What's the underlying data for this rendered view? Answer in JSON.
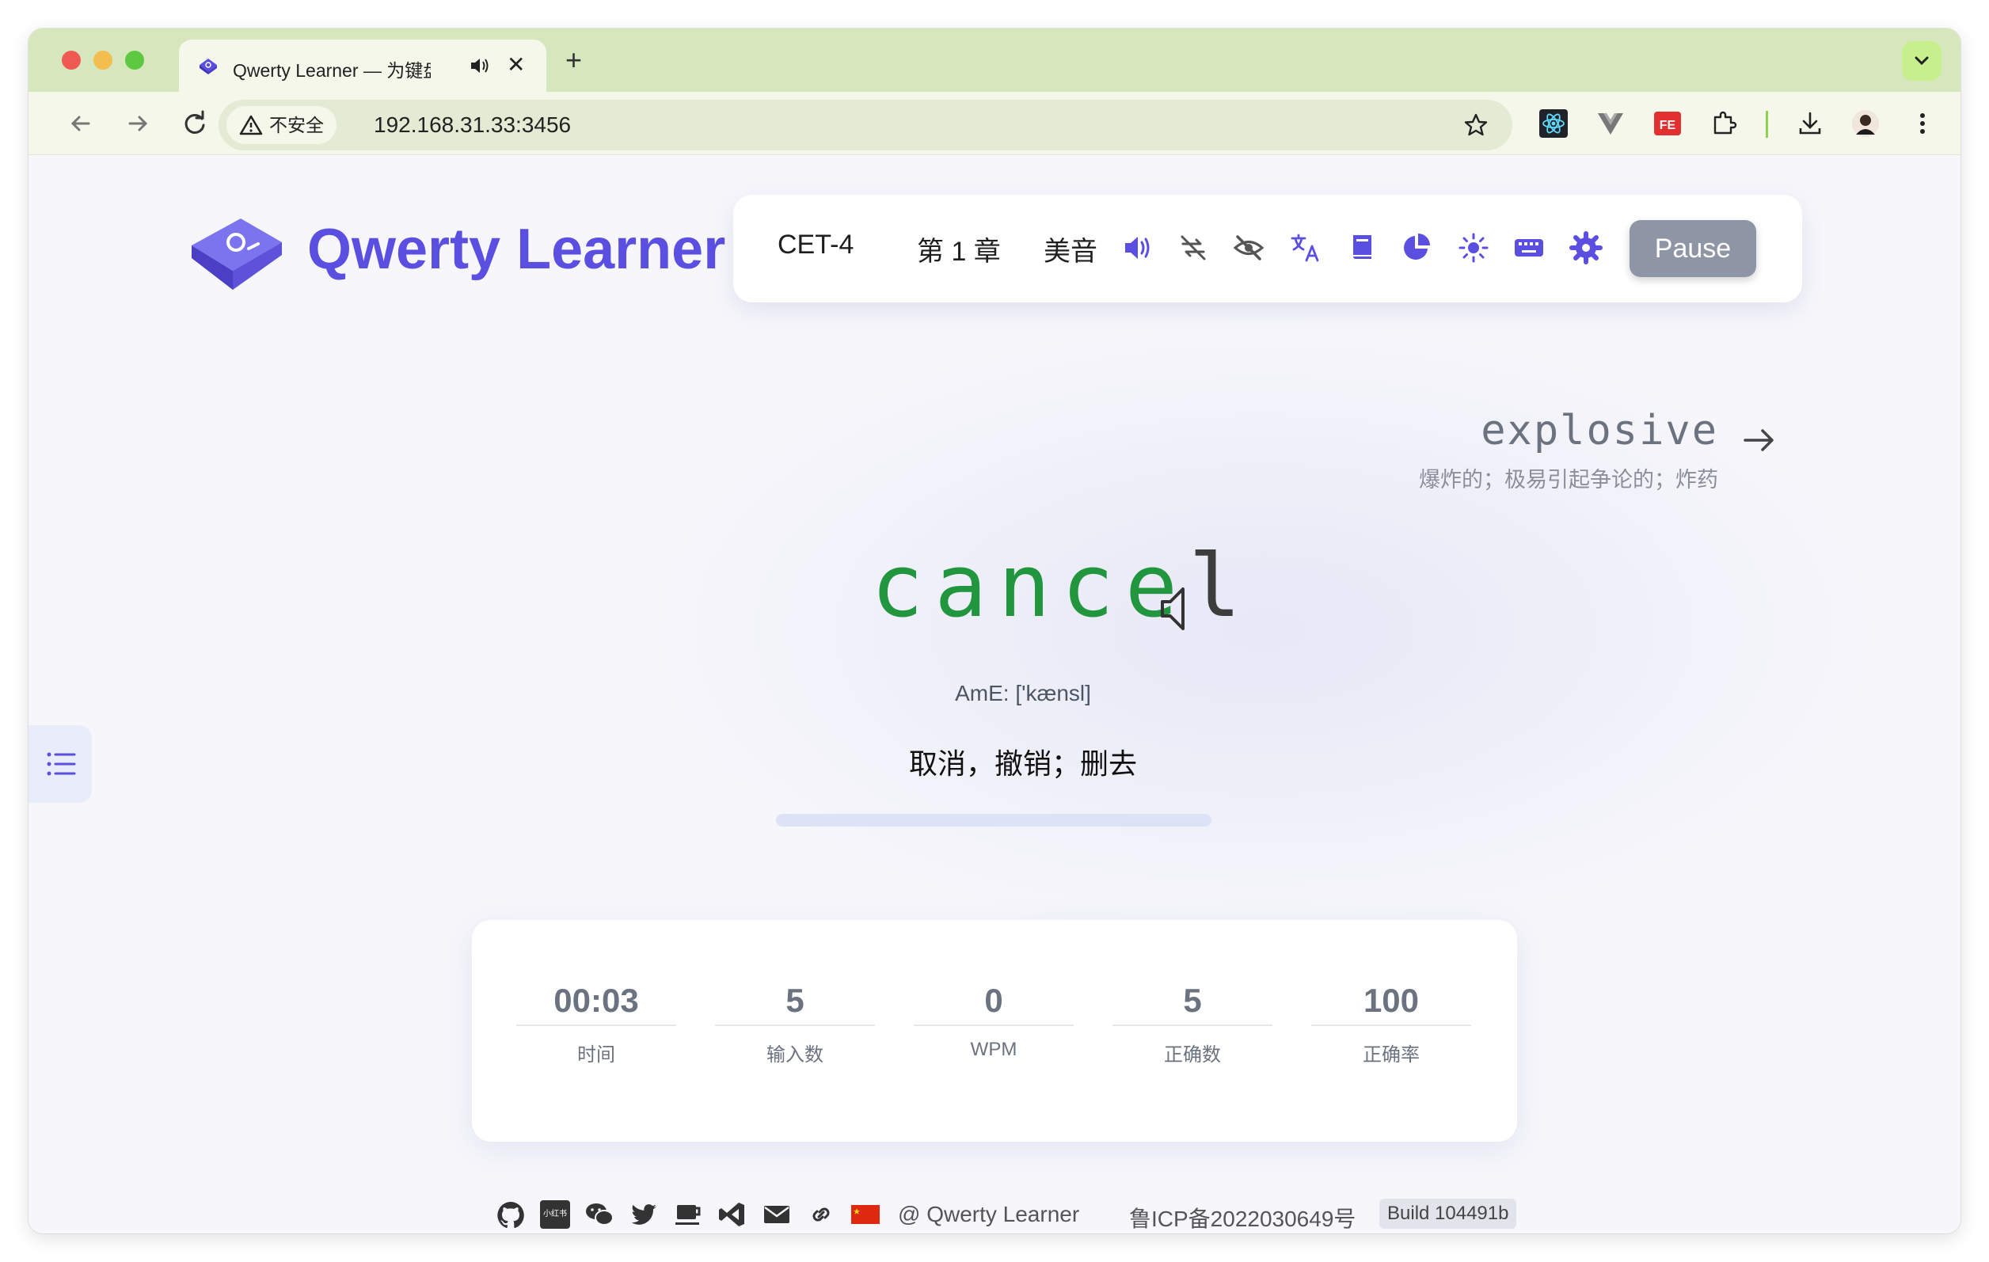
{
  "browser": {
    "tab_title": "Qwerty Learner — 为键盘工作者设计的单词记忆与英语肌肉记忆锻炼软件",
    "tab_close": "✕",
    "new_tab": "+",
    "insecure_label": "不安全",
    "url": "192.168.31.33:3456"
  },
  "app": {
    "brand": "Qwerty Learner",
    "accent_color": "#5a4fe0",
    "menu": {
      "dictionary": "CET-4",
      "chapter": "第 1 章",
      "pronunciation": "美音",
      "pause_label": "Pause",
      "icons": [
        "speaker-icon",
        "loop-off-icon",
        "eye-off-icon",
        "translate-icon",
        "book-icon",
        "pie-chart-icon",
        "sun-icon",
        "keyboard-icon",
        "gear-icon"
      ]
    },
    "next_word": {
      "word": "explosive",
      "translation": "爆炸的；极易引起争论的；炸药"
    },
    "current_word": {
      "typed": "cance",
      "remaining": "l",
      "phonetic": "AmE: ['kænsl]",
      "translation": "取消，撤销；删去",
      "progress_fraction": 0
    },
    "stats": [
      {
        "value": "00:03",
        "label": "时间"
      },
      {
        "value": "5",
        "label": "输入数"
      },
      {
        "value": "0",
        "label": "WPM"
      },
      {
        "value": "5",
        "label": "正确数"
      },
      {
        "value": "100",
        "label": "正确率"
      }
    ],
    "footer": {
      "mini_label": "小红书",
      "copyright": "@ Qwerty Learner",
      "icp": "鲁ICP备2022030649号",
      "build": "Build 104491b"
    }
  }
}
